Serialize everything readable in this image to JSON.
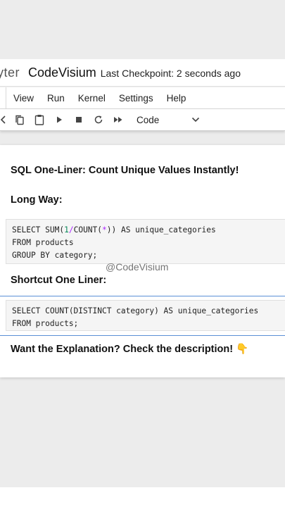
{
  "header": {
    "brand_partial": "yter",
    "notebook_title": "CodeVisium",
    "checkpoint": "Last Checkpoint: 2 seconds ago"
  },
  "menu": {
    "items": [
      "View",
      "Run",
      "Kernel",
      "Settings",
      "Help"
    ]
  },
  "toolbar": {
    "icons": [
      "cut-icon",
      "copy-icon",
      "paste-icon",
      "run-icon",
      "stop-icon",
      "restart-icon",
      "fast-forward-icon"
    ],
    "cell_type": "Code"
  },
  "cells": {
    "title": "SQL One-Liner: Count Unique Values Instantly!",
    "long_way": "Long Way:",
    "long_code": {
      "l1_a": "SELECT SUM(",
      "l1_num": "1",
      "l1_op1": "/",
      "l1_b": "COUNT(",
      "l1_op2": "*",
      "l1_c": ")) AS unique_categories",
      "l2": "FROM products",
      "l3": "GROUP BY category;"
    },
    "shortcut": "Shortcut One Liner:",
    "short_code": {
      "l1": "SELECT COUNT(DISTINCT category) AS unique_categories",
      "l2": "FROM products;"
    },
    "explanation": "Want the Explanation? Check the description! 👇"
  },
  "watermark": "@CodeVisium",
  "colors": {
    "accent": "#5b8fd6",
    "number": "#098658",
    "operator": "#aa22ff"
  }
}
